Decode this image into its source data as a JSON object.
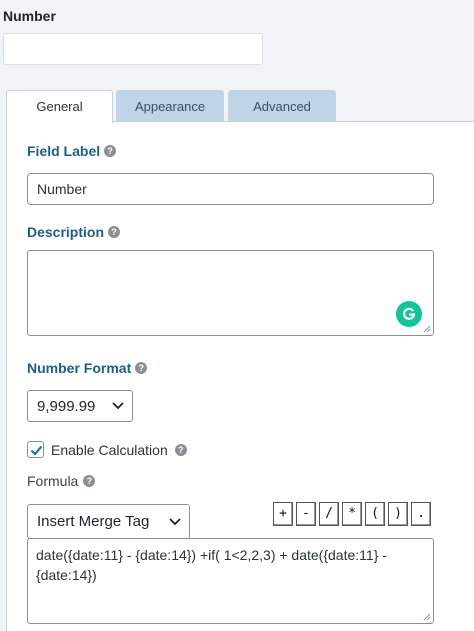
{
  "field_title": "Number",
  "tabs": [
    {
      "label": "General"
    },
    {
      "label": "Appearance"
    },
    {
      "label": "Advanced"
    }
  ],
  "field_label": {
    "heading": "Field Label",
    "value": "Number"
  },
  "description": {
    "heading": "Description",
    "value": ""
  },
  "number_format": {
    "heading": "Number Format",
    "selected": "9,999.99"
  },
  "enable_calculation": {
    "label": "Enable Calculation",
    "checked": true
  },
  "formula": {
    "heading": "Formula",
    "merge_select": "Insert Merge Tag",
    "operators": [
      "+",
      "-",
      "/",
      "*",
      "(",
      ")",
      "."
    ],
    "value": "date({date:11} - {date:14}) +if( 1<2,2,3) + date({date:11} - {date:14})"
  },
  "colors": {
    "accent_heading": "#1e5f84",
    "tab_inactive": "#bfd4e6",
    "grammarly": "#15c39a",
    "checkbox": "#2271b1"
  }
}
